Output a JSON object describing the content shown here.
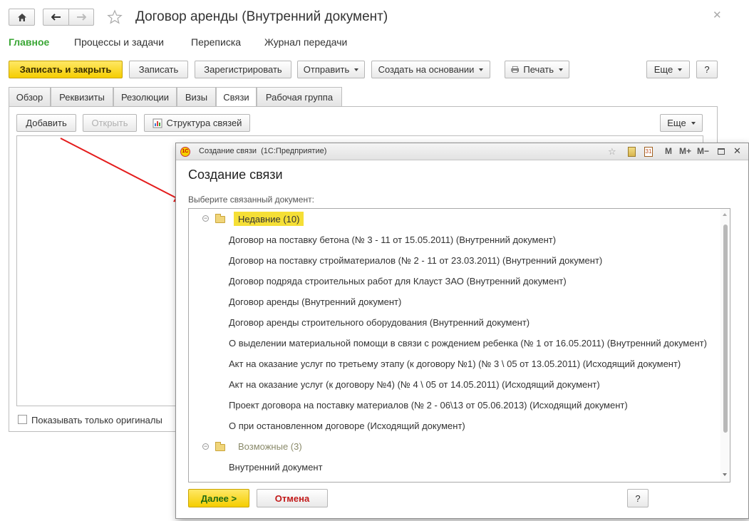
{
  "window": {
    "title": "Договор аренды (Внутренний документ)"
  },
  "nav": {
    "main": "Главное",
    "processes": "Процессы и задачи",
    "correspondence": "Переписка",
    "journal": "Журнал передачи"
  },
  "toolbar": {
    "save_close": "Записать и закрыть",
    "save": "Записать",
    "register": "Зарегистрировать",
    "send": "Отправить",
    "create_based": "Создать на основании",
    "print": "Печать",
    "more": "Еще",
    "help": "?"
  },
  "tabs": {
    "overview": "Обзор",
    "details": "Реквизиты",
    "resolutions": "Резолюции",
    "visas": "Визы",
    "links": "Связи",
    "workgroup": "Рабочая группа"
  },
  "links_panel": {
    "add": "Добавить",
    "open": "Открыть",
    "structure": "Структура связей",
    "more": "Еще",
    "show_originals": "Показывать только оригиналы"
  },
  "dialog": {
    "window_title": "Создание связи  (1С:Предприятие)",
    "heading": "Создание связи",
    "prompt": "Выберите связанный документ:",
    "titlebar_buttons": {
      "m": "M",
      "m_plus": "M+",
      "m_minus": "M−"
    },
    "recent": {
      "label": "Недавние (10)",
      "items": [
        "Договор на поставку бетона (№ 3 - 11 от 15.05.2011) (Внутренний документ)",
        "Договор на поставку стройматериалов (№ 2 - 11 от 23.03.2011) (Внутренний документ)",
        "Договор подряда строительных работ для Клауст ЗАО (Внутренний документ)",
        "Договор аренды (Внутренний документ)",
        "Договор аренды строительного оборудования (Внутренний документ)",
        "О выделении материальной помощи в связи с рождением ребенка (№ 1 от 16.05.2011) (Внутренний документ)",
        "Акт на оказание услуг по третьему этапу (к договору №1) (№ 3 \\ 05 от 13.05.2011) (Исходящий документ)",
        "Акт на оказание услуг (к договору №4) (№ 4 \\ 05 от 14.05.2011) (Исходящий документ)",
        "Проект договора на поставку материалов (№ 2 - 06\\13 от 05.06.2013) (Исходящий документ)",
        "О при остановленном договоре (Исходящий документ)"
      ]
    },
    "possible": {
      "label": "Возможные (3)",
      "items": [
        "Внутренний документ"
      ]
    },
    "next": "Далее >",
    "cancel": "Отмена",
    "help": "?"
  }
}
